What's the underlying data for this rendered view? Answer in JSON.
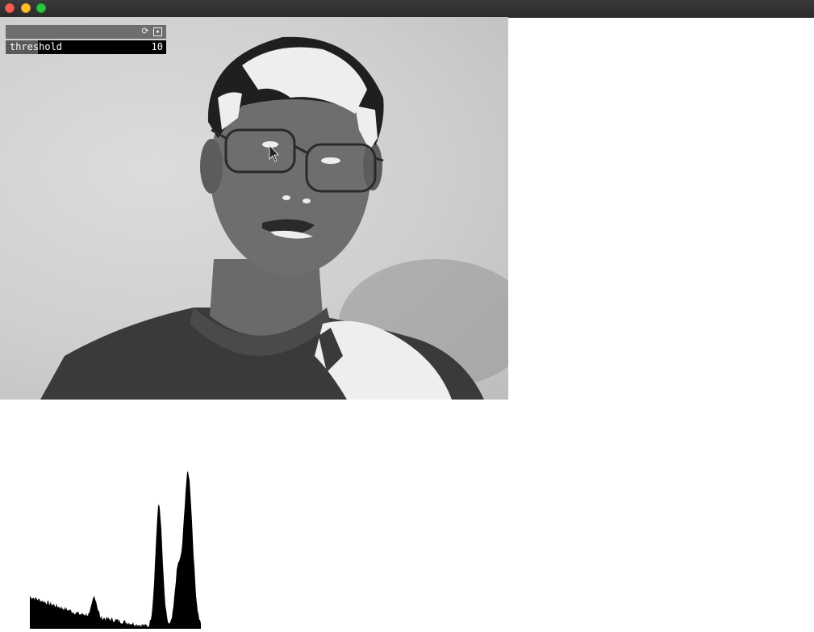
{
  "window": {
    "buttons": [
      "close",
      "minimize",
      "maximize"
    ]
  },
  "gui": {
    "reset_icon": "refresh-icon",
    "save_icon": "save-icon",
    "slider": {
      "label": "threshold",
      "value": "10",
      "fill_fraction": 0.2
    }
  },
  "colors": {
    "titlebar": "#2d2d2d",
    "close": "#fe5f57",
    "minimize": "#febc2e",
    "maximize": "#28c840",
    "slider_bg": "#000000",
    "slider_fill": "#5a5a5a",
    "panel_header": "#6e6e6e"
  }
}
